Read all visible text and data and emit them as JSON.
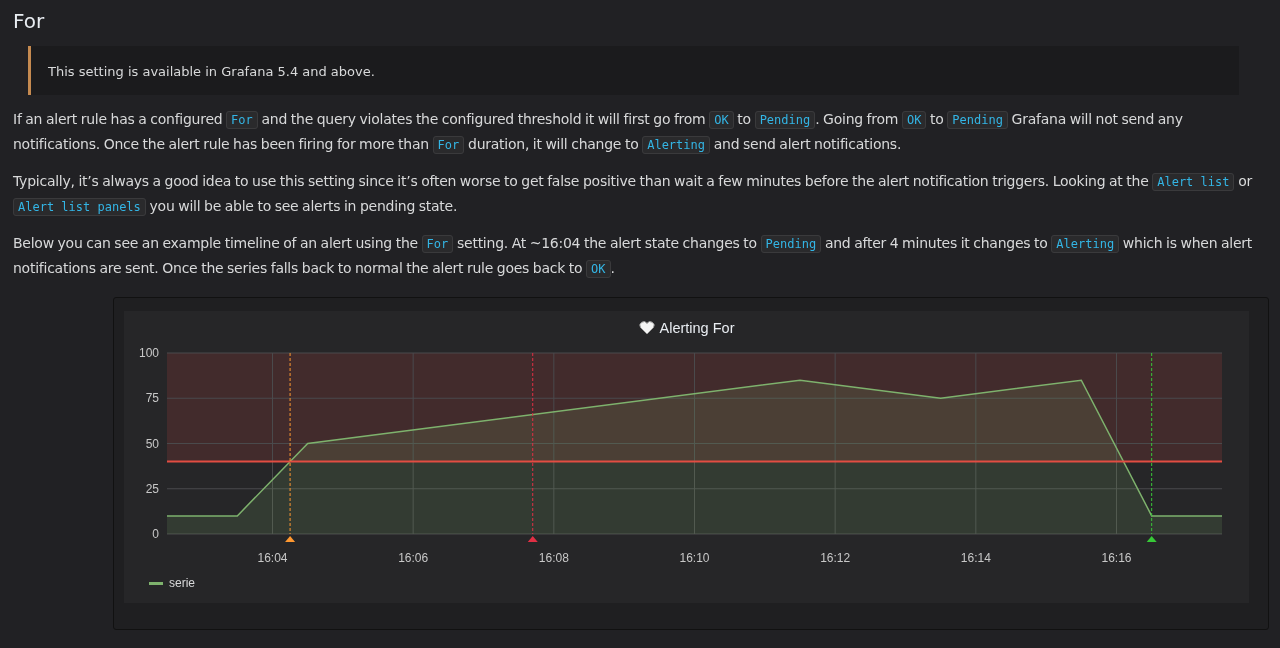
{
  "heading": "For",
  "note": "This setting is available in Grafana 5.4 and above.",
  "paragraphs": [
    [
      {
        "kind": "text",
        "text": "If an alert rule has a configured "
      },
      {
        "kind": "code",
        "text": "For"
      },
      {
        "kind": "text",
        "text": " and the query violates the configured threshold it will first go from "
      },
      {
        "kind": "code",
        "text": "OK"
      },
      {
        "kind": "text",
        "text": " to "
      },
      {
        "kind": "code",
        "text": "Pending"
      },
      {
        "kind": "text",
        "text": ". Going from "
      },
      {
        "kind": "code",
        "text": "OK"
      },
      {
        "kind": "text",
        "text": " to "
      },
      {
        "kind": "code",
        "text": "Pending"
      },
      {
        "kind": "text",
        "text": " Grafana will not send any notifications. Once the alert rule has been firing for more than "
      },
      {
        "kind": "code",
        "text": "For"
      },
      {
        "kind": "text",
        "text": " duration, it will change to "
      },
      {
        "kind": "code",
        "text": "Alerting"
      },
      {
        "kind": "text",
        "text": " and send alert notifications."
      }
    ],
    [
      {
        "kind": "text",
        "text": "Typically, it’s always a good idea to use this setting since it’s often worse to get false positive than wait a few minutes before the alert notification triggers. Looking at the "
      },
      {
        "kind": "code",
        "text": "Alert list"
      },
      {
        "kind": "text",
        "text": " or "
      },
      {
        "kind": "code",
        "text": "Alert list panels"
      },
      {
        "kind": "text",
        "text": " you will be able to see alerts in pending state."
      }
    ],
    [
      {
        "kind": "text",
        "text": "Below you can see an example timeline of an alert using the "
      },
      {
        "kind": "code",
        "text": "For"
      },
      {
        "kind": "text",
        "text": " setting. At ~16:04 the alert state changes to "
      },
      {
        "kind": "code",
        "text": "Pending"
      },
      {
        "kind": "text",
        "text": " and after 4 minutes it changes to "
      },
      {
        "kind": "code",
        "text": "Alerting"
      },
      {
        "kind": "text",
        "text": " which is when alert notifications are sent. Once the series falls back to normal the alert rule goes back to "
      },
      {
        "kind": "code",
        "text": "OK"
      },
      {
        "kind": "text",
        "text": "."
      }
    ]
  ],
  "panel": {
    "chart_data": {
      "type": "area",
      "title": "Alerting For",
      "x": [
        962.5,
        963.5,
        964.5,
        971.5,
        973.5,
        975.5,
        976.5,
        977.5
      ],
      "series": [
        {
          "name": "serie",
          "color": "#7eb26d",
          "values": [
            10,
            10,
            50,
            85,
            75,
            85,
            10,
            10
          ]
        }
      ],
      "xlim": [
        962.5,
        977.5
      ],
      "ylim": [
        0,
        100
      ],
      "xticks": [
        {
          "value": 964,
          "label": "16:04"
        },
        {
          "value": 966,
          "label": "16:06"
        },
        {
          "value": 968,
          "label": "16:08"
        },
        {
          "value": 970,
          "label": "16:10"
        },
        {
          "value": 972,
          "label": "16:12"
        },
        {
          "value": 974,
          "label": "16:14"
        },
        {
          "value": 976,
          "label": "16:16"
        }
      ],
      "yticks": [
        0,
        25,
        50,
        75,
        100
      ],
      "grid": true,
      "bands": [
        {
          "axis": "y",
          "from": 40,
          "to": 100,
          "color": "#e24d42"
        }
      ],
      "ref_lines": [
        {
          "axis": "y",
          "value": 40,
          "color": "#e24d42"
        },
        {
          "axis": "x",
          "value": 964.25,
          "color": "#ff9830"
        },
        {
          "axis": "x",
          "value": 967.7,
          "color": "#e02f44"
        },
        {
          "axis": "x",
          "value": 976.5,
          "color": "#37c837"
        }
      ]
    }
  }
}
